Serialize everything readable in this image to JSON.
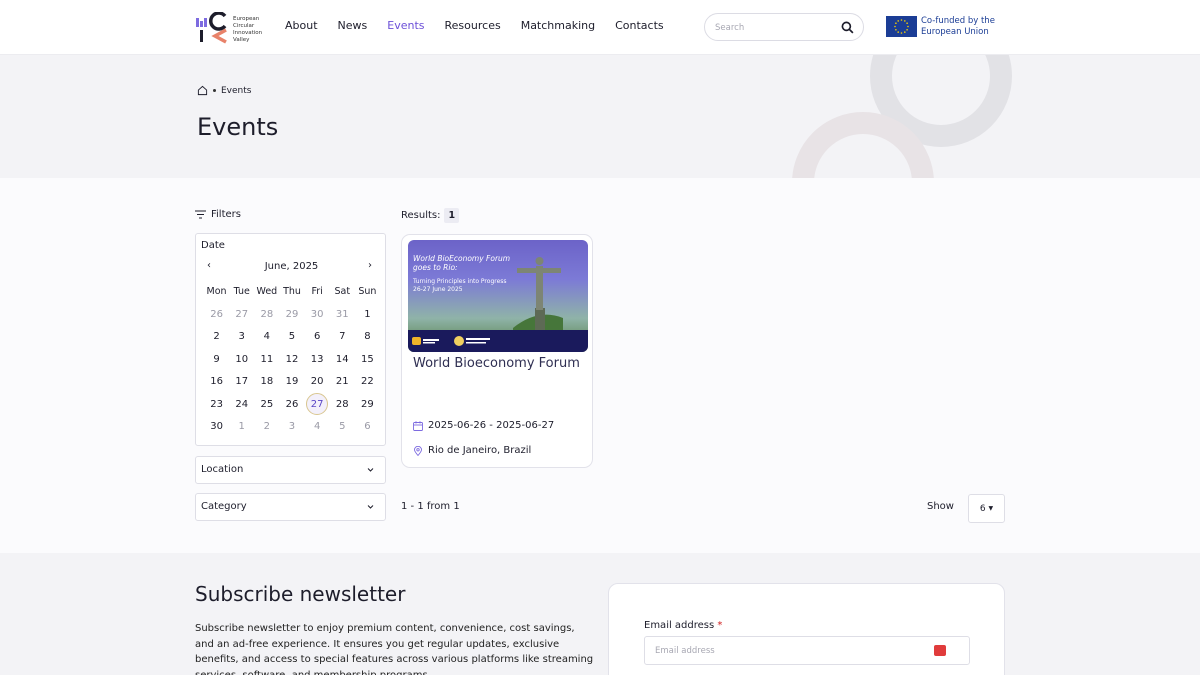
{
  "brand": {
    "logo_text": [
      "European",
      "Circular",
      "Innovation",
      "Valley"
    ],
    "colors": {
      "accent": "#6b4fd8",
      "eu_blue": "#1b3d95"
    }
  },
  "nav": [
    {
      "label": "About",
      "active": false
    },
    {
      "label": "News",
      "active": false
    },
    {
      "label": "Events",
      "active": true
    },
    {
      "label": "Resources",
      "active": false
    },
    {
      "label": "Matchmaking",
      "active": false
    },
    {
      "label": "Contacts",
      "active": false
    }
  ],
  "search": {
    "placeholder": "Search",
    "icon": "search-icon"
  },
  "eu": {
    "line1": "Co-funded by the",
    "line2": "European Union"
  },
  "breadcrumb": {
    "current": "Events",
    "icon": "home-icon"
  },
  "page_title": "Events",
  "filters": {
    "label": "Filters",
    "date_label": "Date",
    "calendar": {
      "month": "June, 2025",
      "weekdays": [
        "Mon",
        "Tue",
        "Wed",
        "Thu",
        "Fri",
        "Sat",
        "Sun"
      ],
      "days": [
        {
          "d": "26",
          "m": true
        },
        {
          "d": "27",
          "m": true
        },
        {
          "d": "28",
          "m": true
        },
        {
          "d": "29",
          "m": true
        },
        {
          "d": "30",
          "m": true
        },
        {
          "d": "31",
          "m": true
        },
        {
          "d": "1",
          "m": false
        },
        {
          "d": "2",
          "m": false
        },
        {
          "d": "3",
          "m": false
        },
        {
          "d": "4",
          "m": false
        },
        {
          "d": "5",
          "m": false
        },
        {
          "d": "6",
          "m": false
        },
        {
          "d": "7",
          "m": false
        },
        {
          "d": "8",
          "m": false
        },
        {
          "d": "9",
          "m": false
        },
        {
          "d": "10",
          "m": false
        },
        {
          "d": "11",
          "m": false
        },
        {
          "d": "12",
          "m": false
        },
        {
          "d": "13",
          "m": false
        },
        {
          "d": "14",
          "m": false
        },
        {
          "d": "15",
          "m": false
        },
        {
          "d": "16",
          "m": false
        },
        {
          "d": "17",
          "m": false
        },
        {
          "d": "18",
          "m": false
        },
        {
          "d": "19",
          "m": false
        },
        {
          "d": "20",
          "m": false
        },
        {
          "d": "21",
          "m": false
        },
        {
          "d": "22",
          "m": false
        },
        {
          "d": "23",
          "m": false
        },
        {
          "d": "24",
          "m": false
        },
        {
          "d": "25",
          "m": false
        },
        {
          "d": "26",
          "m": false
        },
        {
          "d": "27",
          "m": false,
          "today": true
        },
        {
          "d": "28",
          "m": false
        },
        {
          "d": "29",
          "m": false
        },
        {
          "d": "30",
          "m": false
        },
        {
          "d": "1",
          "m": true
        },
        {
          "d": "2",
          "m": true
        },
        {
          "d": "3",
          "m": true
        },
        {
          "d": "4",
          "m": true
        },
        {
          "d": "5",
          "m": true
        },
        {
          "d": "6",
          "m": true
        }
      ]
    },
    "location_label": "Location",
    "category_label": "Category"
  },
  "results": {
    "label": "Results:",
    "count": "1"
  },
  "event": {
    "image_title_line1": "World BioEconomy Forum",
    "image_title_line2": "goes to Rio:",
    "image_sub_line1": "Turning Principles into Progress",
    "image_sub_line2": "26-27 June 2025",
    "title": "World Bioeconomy Forum",
    "dates": "2025-06-26 - 2025-06-27",
    "location": "Rio de Janeiro, Brazil"
  },
  "paging": {
    "text": "1 - 1 from 1",
    "show_label": "Show",
    "show_value": "6"
  },
  "newsletter": {
    "title": "Subscribe newsletter",
    "description": "Subscribe newsletter to enjoy premium content, convenience, cost savings, and an ad-free experience. It ensures you get regular updates, exclusive benefits, and access to special features across various platforms like streaming services, software, and membership programs.",
    "email_label": "Email address",
    "required_mark": "*",
    "email_placeholder": "Email address"
  }
}
